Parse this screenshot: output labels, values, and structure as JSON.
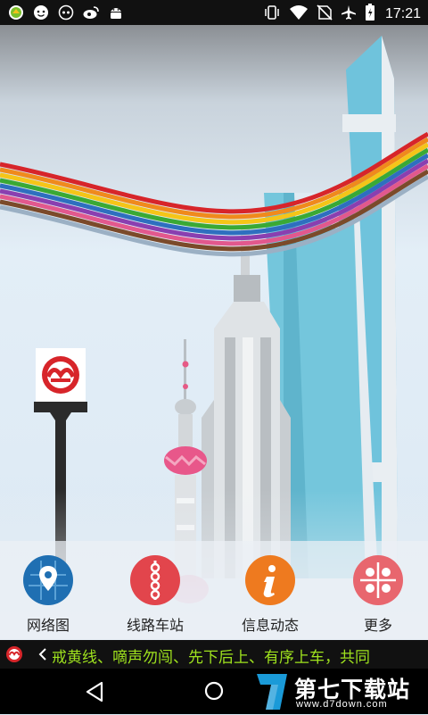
{
  "status_bar": {
    "time": "17:21",
    "left_icons": [
      "notification-app-icon",
      "notification-emoji-icon",
      "notification-game-icon",
      "notification-weibo-icon",
      "android-icon"
    ],
    "right_icons": [
      "vibrate-icon",
      "wifi-icon",
      "no-sim-icon",
      "airplane-icon",
      "battery-icon"
    ]
  },
  "scene": {
    "description_icons": [
      "metro-logo-sign",
      "rainbow-ribbon",
      "shanghai-skyline"
    ],
    "colors": {
      "metro_red": "#d7252a",
      "sky": "#dbeaf5",
      "tower_blue": "#6fc3dc"
    }
  },
  "menu": {
    "items": [
      {
        "label": "网络图",
        "icon": "map-pin-icon",
        "color": "#1f6fb2"
      },
      {
        "label": "线路车站",
        "icon": "route-line-icon",
        "color": "#e2454c"
      },
      {
        "label": "信息动态",
        "icon": "info-icon",
        "color": "#ee7a1f"
      },
      {
        "label": "更多",
        "icon": "grid-icon",
        "color": "#e8666e"
      }
    ]
  },
  "ticker": {
    "text": "戒黄线、嘀声勿闯、先下后上、有序上车，共同"
  },
  "nav_bar": {
    "icons": [
      "back-icon",
      "home-icon"
    ]
  },
  "watermark": {
    "title": "第七下载站",
    "url": "www.d7down.com"
  }
}
